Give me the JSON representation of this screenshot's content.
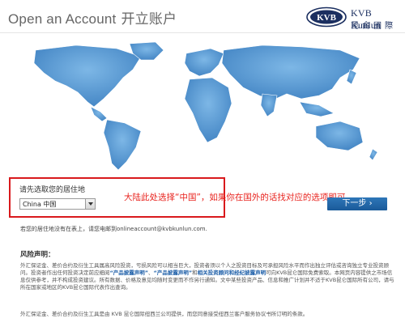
{
  "header": {
    "title_en": "Open an Account",
    "title_cn": "开立账户",
    "logo_letters": "KVB",
    "brand_en": "KVB Kunlun",
    "brand_cn": "昆侖國際"
  },
  "residence": {
    "label": "请先选取您的居住地",
    "select_value": "China 中国"
  },
  "annotation": "大陆此处选择“中国”，如果你在国外的话找对应的选项即可",
  "next_button": "下一步 ›",
  "missing_text": "若您的居住地没有在表上，请您电邮到onlineaccount@kvbkunlun.com.",
  "risk": {
    "title": "风险声明：",
    "p1_a": "外汇保证金、差价合约及衍生工具属高风险投资，亏损风险可以相当巨大，投资者须以个人之投资目标及可承担风险水平而作出独立评估或咨询独立专业投资顾问。投资者作出任何投资决定前应细阅",
    "link1": "“产品披露声明”",
    "p1_b": "、",
    "link2": "“产品披露声明”",
    "p1_c": "和",
    "link3": "相关投资顾问和经纪披露声明",
    "p1_d": "可向KVB昆仑国际免费索取。本网页内容提供之市场信息仅供参考，并不构成投资建议。所有数据、价格及意见均随时变更而不作另行通知。文中某些投资产品、信息和推广计划并不适于KVB昆仑国际所有公司，请与所在国家或地区的KVB昆仑国际代表作出查询。"
  },
  "footer": "外汇保证金、差价合约及衍生工具是由 KVB 昆仑国际纽西兰公司提供，而您同意接受纽西兰客户服务协议书所订明的条款。",
  "colors": {
    "accent_red": "#d9191c",
    "button_blue": "#1f63a6",
    "map_blue": "#4a8fc9"
  }
}
